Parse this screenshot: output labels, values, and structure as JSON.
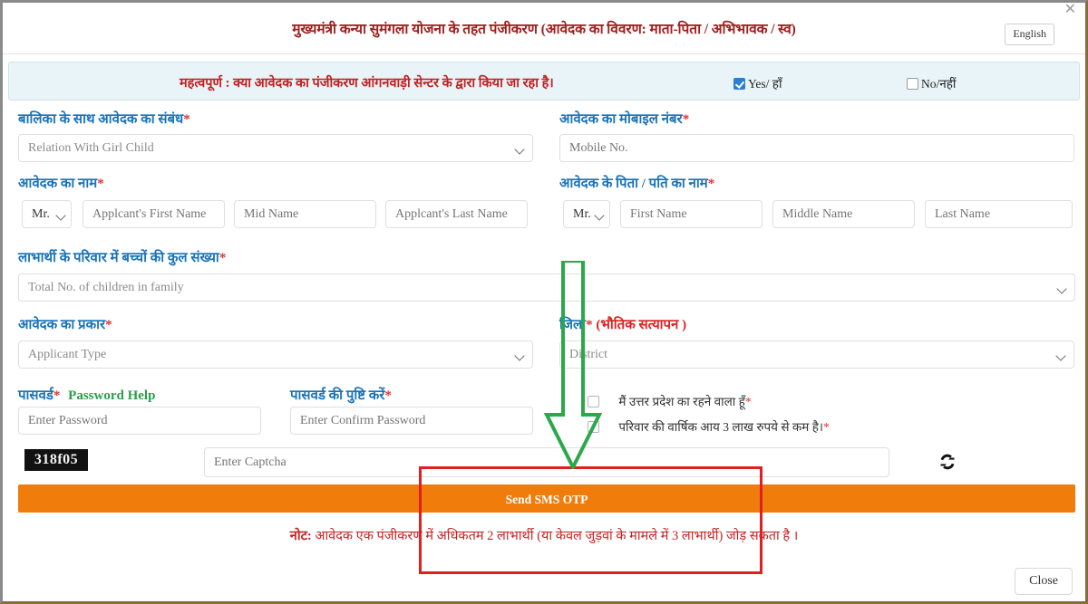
{
  "window": {
    "close_x_icon": "close-icon",
    "title": "मुख्यमंत्री कन्या सुमंगला योजना के तहत पंजीकरण (आवेदक का विवरण: माता-पिता / अभिभावक / स्व)",
    "language_button": "English",
    "footer_close": "Close"
  },
  "notice": {
    "lead": "महत्वपूर्ण",
    "body": " : क्या आवेदक का पंजीकरण आंगनवाड़ी सेन्टर के द्वारा किया जा रहा है।",
    "yes_label": "Yes/ हाँ",
    "yes_checked": true,
    "no_label": "No/नहीं",
    "no_checked": false
  },
  "fields": {
    "relation": {
      "label": "बालिका के साथ आवेदक का संबंध",
      "required": "*",
      "value": "Relation With Girl Child",
      "control": "select"
    },
    "mobile": {
      "label": "आवेदक का मोबाइल नंबर",
      "required": "*",
      "placeholder": "Mobile No.",
      "value": "",
      "control": "text"
    },
    "applicant_name": {
      "label": "आवेदक का नाम",
      "required": "*",
      "title": "Mr.",
      "first_placeholder": "Applcant's First Name",
      "mid_placeholder": "Mid Name",
      "last_placeholder": "Applcant's Last Name"
    },
    "father_name": {
      "label": "आवेदक के पिता / पति का नाम",
      "required": "*",
      "title": "Mr.",
      "first_placeholder": "First Name",
      "mid_placeholder": "Middle Name",
      "last_placeholder": "Last Name"
    },
    "children": {
      "label": "लाभार्थी के परिवार में बच्चों की कुल संख्या",
      "required": "*",
      "value": "Total No. of children in family",
      "control": "select"
    },
    "applicant_type": {
      "label": "आवेदक का प्रकार",
      "required": "*",
      "value": "Applicant Type",
      "control": "select"
    },
    "district": {
      "label": "जिला",
      "required": "*",
      "label_suffix": " (भौतिक सत्यापन )",
      "value": "District",
      "control": "select"
    },
    "password": {
      "label": "पासवर्ड",
      "required": "*",
      "help_link": "Password Help",
      "placeholder": "Enter Password"
    },
    "confirm_password": {
      "label": "पासवर्ड की पुष्टि करें",
      "required": "*",
      "placeholder": "Enter Confirm Password"
    }
  },
  "declarations": [
    {
      "text": "मैं उत्तर प्रदेश का रहने वाला हूँ",
      "required": "*",
      "checked": false
    },
    {
      "text": "परिवार की वार्षिक आय 3 लाख रुपये से कम है।",
      "required": "*",
      "checked": false
    }
  ],
  "captcha": {
    "code": "318f05",
    "placeholder": "Enter Captcha",
    "value": "",
    "refresh_icon": "refresh-icon"
  },
  "otp_button": "Send SMS OTP",
  "note": {
    "lead": "नोट:",
    "body": " आवेदक एक पंजीकरण में अधिकतम 2 लाभार्थी (या केवल जुड़वां के मामले में 3 लाभार्थी) जोड़ सकता है ।"
  },
  "annotations": {
    "highlight_box_color": "#e02020",
    "arrow_color": "#2aa84a"
  },
  "colors": {
    "label_blue": "#1a73b7",
    "required_red": "#d33333",
    "notice_red": "#c22020",
    "accent_orange": "#f07c0c",
    "notice_bg": "#e8f4f8",
    "checkbox_blue": "#2a7fd4",
    "help_green": "#2a9d4a"
  }
}
